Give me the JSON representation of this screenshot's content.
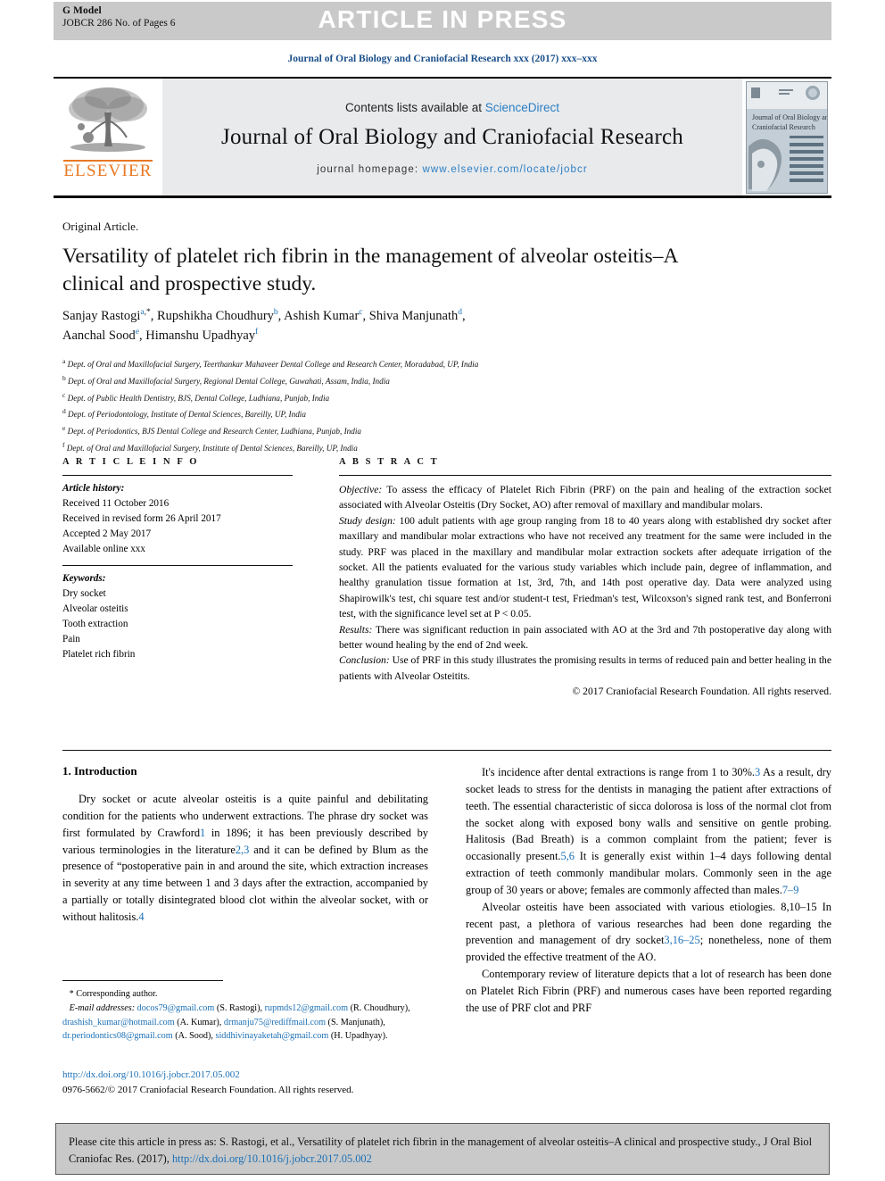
{
  "banner": {
    "g_model": "G Model",
    "model_id": "JOBCR 286 No. of Pages 6",
    "press_title": "ARTICLE IN PRESS"
  },
  "running_head": "Journal of Oral Biology and Craniofacial Research xxx (2017) xxx–xxx",
  "masthead": {
    "publisher": "ELSEVIER",
    "contents_prefix": "Contents lists available at ",
    "contents_link": "ScienceDirect",
    "journal_name": "Journal of Oral Biology and Craniofacial Research",
    "homepage_label": "journal homepage:",
    "homepage_url": "www.elsevier.com/locate/jobcr",
    "cover_title_1": "Journal of Oral Biology and",
    "cover_title_2": "Craniofacial Research"
  },
  "article": {
    "kicker": "Original Article.",
    "title": "Versatility of platelet rich fibrin in the management of alveolar osteitis–A clinical and prospective study.",
    "authors": [
      {
        "name": "Sanjay Rastogi",
        "sup": "a",
        "star": true
      },
      {
        "name": "Rupshikha Choudhury",
        "sup": "b",
        "star": false
      },
      {
        "name": "Ashish Kumar",
        "sup": "c",
        "star": false
      },
      {
        "name": "Shiva Manjunath",
        "sup": "d",
        "star": false
      },
      {
        "name": "Aanchal Sood",
        "sup": "e",
        "star": false
      },
      {
        "name": "Himanshu Upadhyay",
        "sup": "f",
        "star": false
      }
    ],
    "affiliations": [
      {
        "mark": "a",
        "text": "Dept. of Oral and Maxillofacial Surgery, Teerthankar Mahaveer Dental College and Research Center, Moradabad, UP, India"
      },
      {
        "mark": "b",
        "text": "Dept. of Oral and Maxillofacial Surgery, Regional Dental College, Guwahati, Assam, India, India"
      },
      {
        "mark": "c",
        "text": "Dept. of Public Health Dentistry, BJS, Dental College, Ludhiana, Punjab, India"
      },
      {
        "mark": "d",
        "text": "Dept. of Periodontology, Institute of Dental Sciences, Bareilly, UP, India"
      },
      {
        "mark": "e",
        "text": "Dept. of Periodontics, BJS Dental College and Research Center, Ludhiana, Punjab, India"
      },
      {
        "mark": "f",
        "text": "Dept. of Oral and Maxillofacial Surgery, Institute of Dental Sciences, Bareilly, UP, India"
      }
    ]
  },
  "article_info": {
    "heading": "A R T I C L E   I N F O",
    "history_label": "Article history:",
    "history": [
      "Received 11 October 2016",
      "Received in revised form 26 April 2017",
      "Accepted 2 May 2017",
      "Available online xxx"
    ],
    "keywords_label": "Keywords:",
    "keywords": [
      "Dry socket",
      "Alveolar osteitis",
      "Tooth extraction",
      "Pain",
      "Platelet rich fibrin"
    ]
  },
  "abstract": {
    "heading": "A B S T R A C T",
    "objective_label": "Objective:",
    "objective_text": " To assess the efficacy of Platelet Rich Fibrin (PRF) on the pain and healing of the extraction socket associated with Alveolar Osteitis (Dry Socket, AO) after removal of maxillary and mandibular molars.",
    "design_label": "Study design:",
    "design_text": " 100 adult patients with age group ranging from 18 to 40 years along with established dry socket after maxillary and mandibular molar extractions who have not received any treatment for the same were included in the study. PRF was placed in the maxillary and mandibular molar extraction sockets after adequate irrigation of the socket. All the patients evaluated for the various study variables which include pain, degree of inflammation, and healthy granulation tissue formation at 1st, 3rd, 7th, and 14th post operative day. Data were analyzed using Shapirowilk's test, chi square test and/or student-t test, Friedman's test, Wilcoxson's signed rank test, and Bonferroni test, with the significance level set at P < 0.05.",
    "results_label": "Results:",
    "results_text": " There was significant reduction in pain associated with AO at the 3rd and 7th postoperative day along with better wound healing by the end of 2nd week.",
    "conclusion_label": "Conclusion:",
    "conclusion_text": " Use of PRF in this study illustrates the promising results in terms of reduced pain and better healing in the patients with Alveolar Osteitits.",
    "copyright": "© 2017 Craniofacial Research Foundation. All rights reserved."
  },
  "introduction": {
    "heading": "1. Introduction",
    "left_paragraphs": [
      "Dry socket or acute alveolar osteitis is a quite painful and debilitating condition for the patients who underwent extractions. The phrase dry socket was first formulated by Crawford1 in 1896; it has been previously described by various terminologies in the literature2,3 and it can be defined by Blum as the presence of “postoperative pain in and around the site, which extraction increases in severity at any time between 1 and 3 days after the extraction, accompanied by a partially or totally disintegrated blood clot within the alveolar socket, with or without halitosis.4"
    ],
    "right_paragraphs": [
      "It's incidence after dental extractions is range from 1 to 30%.3 As a result, dry socket leads to stress for the dentists in managing the patient after extractions of teeth. The essential characteristic of sicca dolorosa is loss of the normal clot from the socket along with exposed bony walls and sensitive on gentle probing. Halitosis (Bad Breath) is a common complaint from the patient; fever is occasionally present.5,6 It is generally exist within 1–4 days following dental extraction of teeth commonly mandibular molars. Commonly seen in the age group of 30 years or above; females are commonly affected than males.7–9",
      "Alveolar osteitis have been associated with various etiologies. 8,10–15 In recent past, a plethora of various researches had been done regarding the prevention and management of dry socket3,16–25; nonetheless, none of them provided the effective treatment of the AO.",
      "Contemporary review of literature depicts that a lot of research has been done on Platelet Rich Fibrin (PRF) and numerous cases have been reported regarding the use of PRF clot and PRF"
    ]
  },
  "footnote": {
    "corresponding_marker": "*",
    "corresponding_label": "Corresponding author.",
    "emails_label": "E-mail addresses:",
    "emails": [
      {
        "address": "docos79@gmail.com",
        "owner": "(S. Rastogi)"
      },
      {
        "address": "rupmds12@gmail.com",
        "owner": "(R. Choudhury)"
      },
      {
        "address": "drashish_kumar@hotmail.com",
        "owner": "(A. Kumar)"
      },
      {
        "address": "drmanju75@rediffmail.com",
        "owner": "(S. Manjunath)"
      },
      {
        "address": "dr.periodontics08@gmail.com",
        "owner": "(A. Sood)"
      },
      {
        "address": "siddhivinayaketah@gmail.com",
        "owner": "(H. Upadhyay)"
      }
    ],
    "doi_url": "http://dx.doi.org/10.1016/j.jobcr.2017.05.002",
    "issn_line": "0976-5662/© 2017 Craniofacial Research Foundation. All rights reserved."
  },
  "cite_box": {
    "text": "Please cite this article in press as: S. Rastogi, et al., Versatility of platelet rich fibrin in the management of alveolar osteitis–A clinical and prospective study., J Oral Biol Craniofac Res. (2017), ",
    "doi": "http://dx.doi.org/10.1016/j.jobcr.2017.05.002"
  },
  "colors": {
    "link_blue": "#1a6fb5",
    "elsevier_orange": "#E87722",
    "banner_grey": "#c9c9c9",
    "masthead_grey": "#e9eaec"
  }
}
